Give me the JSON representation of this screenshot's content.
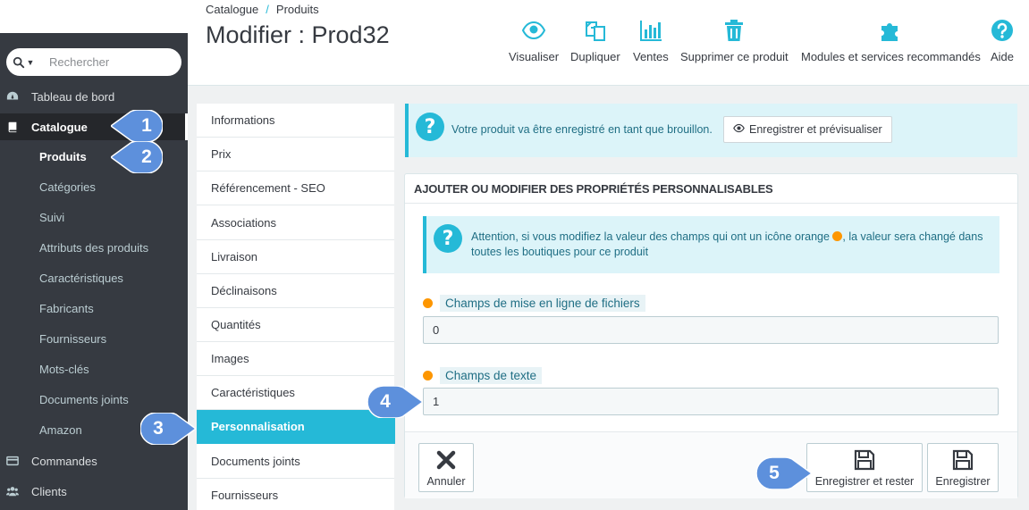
{
  "sidebar": {
    "search_placeholder": "Rechercher",
    "main_items": [
      {
        "label": "Tableau de bord",
        "icon": "dashboard-icon"
      },
      {
        "label": "Catalogue",
        "icon": "catalog-book-icon"
      },
      {
        "label": "Commandes",
        "icon": "credit-card-icon"
      },
      {
        "label": "Clients",
        "icon": "users-icon"
      }
    ],
    "sub_items": [
      "Produits",
      "Catégories",
      "Suivi",
      "Attributs des produits",
      "Caractéristiques",
      "Fabricants",
      "Fournisseurs",
      "Mots-clés",
      "Documents joints",
      "Amazon"
    ]
  },
  "header": {
    "breadcrumb": [
      "Catalogue",
      "Produits"
    ],
    "breadcrumb_separator": "/",
    "title": "Modifier : Prod32",
    "toolbar": [
      {
        "label": "Visualiser",
        "icon": "eye-icon"
      },
      {
        "label": "Dupliquer",
        "icon": "copy-icon"
      },
      {
        "label": "Ventes",
        "icon": "bar-chart-icon"
      },
      {
        "label": "Supprimer ce produit",
        "icon": "trash-icon"
      },
      {
        "label": "Modules et services recommandés",
        "icon": "puzzle-icon"
      },
      {
        "label": "Aide",
        "icon": "help-icon"
      }
    ]
  },
  "tabs": [
    "Informations",
    "Prix",
    "Référencement - SEO",
    "Associations",
    "Livraison",
    "Déclinaisons",
    "Quantités",
    "Images",
    "Caractéristiques",
    "Personnalisation",
    "Documents joints",
    "Fournisseurs"
  ],
  "active_tab": "Personnalisation",
  "draft_alert": {
    "text": "Votre produit va être enregistré en tant que brouillon.",
    "button": "Enregistrer et prévisualiser"
  },
  "panel": {
    "heading": "AJOUTER OU MODIFIER DES PROPRIÉTÉS PERSONNALISABLES",
    "warning_part1": "Attention, si vous modifiez la valeur des champs qui ont un icône orange ",
    "warning_part2": ", la valeur sera changé dans toutes les boutiques pour ce produit",
    "fields": [
      {
        "label": "Champs de mise en ligne de fichiers",
        "value": "0"
      },
      {
        "label": "Champs de texte",
        "value": "1"
      }
    ],
    "buttons": {
      "cancel": "Annuler",
      "save_and_stay": "Enregistrer et rester",
      "save": "Enregistrer"
    }
  },
  "callouts": [
    "1",
    "2",
    "3",
    "4",
    "5"
  ],
  "colors": {
    "sidebar_bg": "#363a41",
    "accent": "#25b9d7",
    "callout": "#5d90dc",
    "orange_dot": "#fd9600",
    "alert_bg": "#dcf4f9"
  }
}
